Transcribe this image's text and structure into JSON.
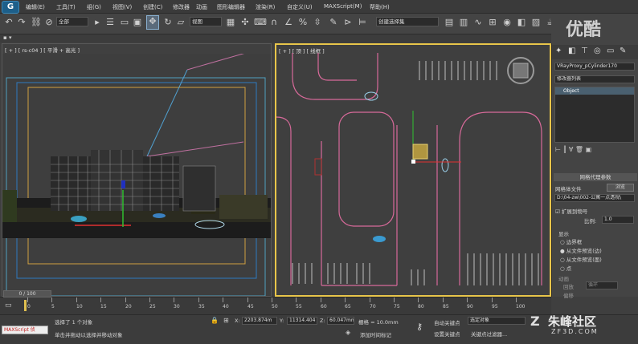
{
  "menu": [
    "编辑(E)",
    "工具(T)",
    "组(G)",
    "视图(V)",
    "创建(C)",
    "修改器",
    "动画",
    "图形编辑器",
    "渲染(R)",
    "自定义(U)",
    "MAXScript(M)",
    "帮助(H)"
  ],
  "toolbar": {
    "selection_filter": "全部",
    "ref_coord": "视图",
    "named_selection": "创建选择集"
  },
  "viewports": {
    "left_label": "[ + ] [ rs-c04 ] [ 平滑 + 高光 ]",
    "right_label": "[ + ] [ 顶 ] [ 线框 ]"
  },
  "command_panel": {
    "object_name": "VRayProxy_pCylinder170",
    "modifier_list": "修改器列表",
    "stack_item": "Object",
    "rollout_title": "网格代理参数",
    "mesh_file_label": "网格体文件",
    "browse_button": "浏览",
    "mesh_file_path": "D:\\04-zw\\002-公寓一点透视\\",
    "expand_uv_label": "扩展到物号",
    "scale_label": "比例:",
    "scale_value": "1.0",
    "display_label": "显示",
    "display_options": [
      "边界框",
      "从文件预览(边)",
      "从文件预览(面)",
      "点"
    ],
    "anim_label": "动画",
    "anim_type_label": "回放",
    "anim_type_value": "循环",
    "offset_label": "偏移"
  },
  "timeline": {
    "frame_display": "0 / 100",
    "ticks": [
      "0",
      "5",
      "10",
      "15",
      "20",
      "25",
      "30",
      "35",
      "40",
      "45",
      "50",
      "55",
      "60",
      "65",
      "70",
      "75",
      "80",
      "85",
      "90",
      "95",
      "100"
    ]
  },
  "status": {
    "maxscript_label": "MAXScript 侦",
    "selection_text": "选择了 1 个对象",
    "prompt_text": "单击并拖动以选择并移动对象",
    "x_label": "X:",
    "x_value": "2203.874m",
    "y_label": "Y:",
    "y_value": "11314.404",
    "z_label": "Z:",
    "z_value": "60.047mm",
    "grid_text": "栅格 = 10.0mm",
    "add_time_tag": "添加时间标记",
    "auto_key": "自动关键点",
    "set_key": "设置关键点",
    "key_mode": "选定对象",
    "key_filters": "关键点过滤器..."
  },
  "watermarks": {
    "top_right": "优酷",
    "bottom_right": "朱峰社区",
    "bottom_right_url": "ZF3D.COM"
  }
}
